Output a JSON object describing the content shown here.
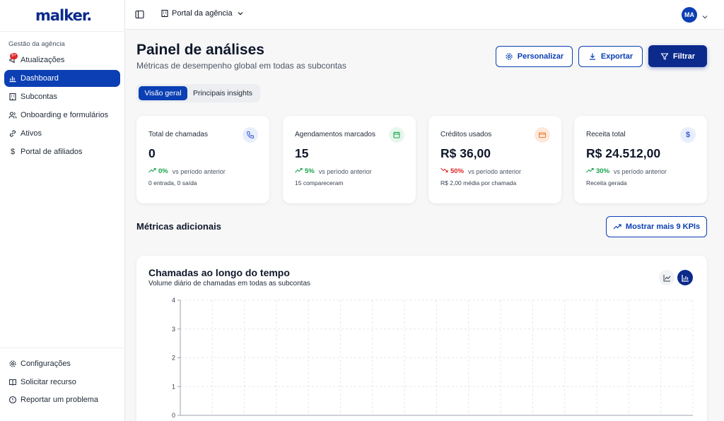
{
  "brand": {
    "logo": "malker."
  },
  "sidebar": {
    "section_label": "Gestão da agência",
    "items": [
      {
        "label": "Atualizações",
        "icon": "megaphone-icon",
        "badge": "9+"
      },
      {
        "label": "Dashboard",
        "icon": "bar-chart-icon",
        "active": true
      },
      {
        "label": "Subcontas",
        "icon": "building-icon"
      },
      {
        "label": "Onboarding e formulários",
        "icon": "users-icon"
      },
      {
        "label": "Ativos",
        "icon": "link-icon"
      },
      {
        "label": "Portal de afiliados",
        "icon": "dollar-icon"
      }
    ],
    "bottom_items": [
      {
        "label": "Configurações",
        "icon": "gear-icon"
      },
      {
        "label": "Solicitar recurso",
        "icon": "book-icon"
      },
      {
        "label": "Reportar um problema",
        "icon": "alert-circle-icon"
      }
    ]
  },
  "header": {
    "agency_label": "Portal da agência",
    "avatar_initials": "MA"
  },
  "page": {
    "title": "Painel de análises",
    "subtitle": "Métricas de desempenho global em todas as subcontas",
    "buttons": {
      "customize": "Personalizar",
      "export": "Exportar",
      "filter": "Filtrar"
    },
    "tabs": [
      "Visão geral",
      "Principais insights"
    ]
  },
  "cards": [
    {
      "label": "Total de chamadas",
      "value": "0",
      "delta": "0%",
      "trend": "up",
      "comparison": "vs período anterior",
      "note": "0 entrada, 0 saída",
      "icon": "phone-icon",
      "icon_color": "#3b5bdb",
      "icon_bg": "#e8eefc"
    },
    {
      "label": "Agendamentos marcados",
      "value": "15",
      "delta": "5%",
      "trend": "up",
      "comparison": "vs período anterior",
      "note": "15 compareceram",
      "icon": "calendar-icon",
      "icon_color": "#16a34a",
      "icon_bg": "#e6f7ec"
    },
    {
      "label": "Créditos usados",
      "value": "R$ 36,00",
      "delta": "50%",
      "trend": "down",
      "comparison": "vs período anterior",
      "note": "R$ 2,00 média por chamada",
      "icon": "credit-card-icon",
      "icon_color": "#ea7a2a",
      "icon_bg": "#fde9dc"
    },
    {
      "label": "Receita total",
      "value": "R$ 24.512,00",
      "delta": "30%",
      "trend": "up",
      "comparison": "vs período anterior",
      "note": "Receita gerada",
      "icon": "dollar-icon",
      "icon_color": "#3b5bdb",
      "icon_bg": "#e8eefc"
    }
  ],
  "additional": {
    "title": "Métricas adicionais",
    "show_more": "Mostrar mais 9 KPIs"
  },
  "chart_data": {
    "type": "bar",
    "title": "Chamadas ao longo do tempo",
    "subtitle": "Volume diário de chamadas em todas as subcontas",
    "ylim": [
      0,
      4
    ],
    "yticks": [
      "0",
      "1",
      "2",
      "3",
      "4"
    ],
    "grid": true,
    "series": []
  },
  "colors": {
    "primary": "#0b3fb3",
    "primary_dark": "#0b2a8c"
  }
}
